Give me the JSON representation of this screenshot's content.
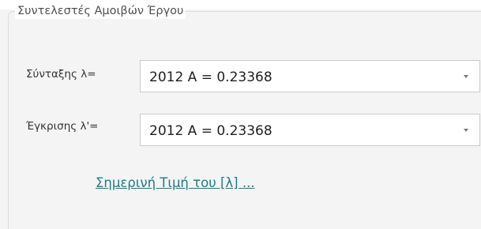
{
  "group": {
    "title": "Συντελεστές Αμοιβών Έργου"
  },
  "fields": [
    {
      "label": "Σύνταξης λ=",
      "value": "2012 A = 0.23368"
    },
    {
      "label": "Έγκρισης λ'=",
      "value": "2012 A = 0.23368"
    }
  ],
  "link": {
    "label": "Σημερινή Τιμή του [λ] ..."
  },
  "icons": {
    "dropdown": "chevron-down-icon"
  }
}
